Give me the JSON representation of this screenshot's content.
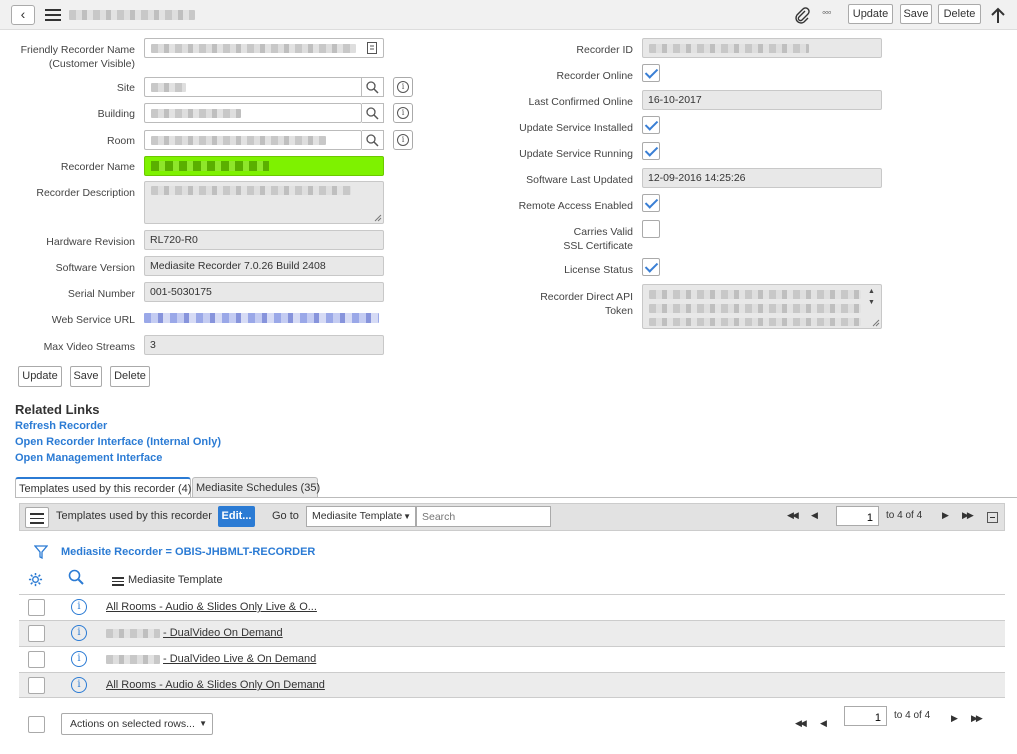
{
  "header": {
    "update_label": "Update",
    "save_label": "Save",
    "delete_label": "Delete",
    "more_glyph": "◦◦◦"
  },
  "form": {
    "friendly_name_label": "Friendly Recorder Name (Customer Visible)",
    "site_label": "Site",
    "building_label": "Building",
    "room_label": "Room",
    "recorder_name_label": "Recorder Name",
    "recorder_name_color": "#7ef200",
    "description_label": "Recorder Description",
    "hardware_revision_label": "Hardware Revision",
    "hardware_revision_value": "RL720-R0",
    "software_version_label": "Software Version",
    "software_version_value": "Mediasite Recorder 7.0.26 Build 2408",
    "serial_number_label": "Serial Number",
    "serial_number_value": "001-5030175",
    "web_service_url_label": "Web Service URL",
    "max_video_streams_label": "Max Video Streams",
    "max_video_streams_value": "3",
    "recorder_id_label": "Recorder ID",
    "recorder_online_label": "Recorder Online",
    "recorder_online": true,
    "last_confirmed_label": "Last Confirmed Online",
    "last_confirmed_value": "16-10-2017",
    "update_service_installed_label": "Update Service Installed",
    "update_service_installed": true,
    "update_service_running_label": "Update Service Running",
    "update_service_running": true,
    "software_last_updated_label": "Software Last Updated",
    "software_last_updated_value": "12-09-2016 14:25:26",
    "remote_access_label": "Remote Access Enabled",
    "remote_access": true,
    "valid_ssl_label": "Carries Valid SSL Certificate",
    "valid_ssl": false,
    "license_status_label": "License Status",
    "license_status": true,
    "api_token_label": "Recorder Direct API Token"
  },
  "form_buttons": {
    "update_label": "Update",
    "save_label": "Save",
    "delete_label": "Delete"
  },
  "related_links": {
    "title": "Related Links",
    "items": [
      "Refresh Recorder",
      "Open Recorder Interface (Internal Only)",
      "Open Management Interface"
    ]
  },
  "tabs": [
    {
      "label": "Templates used by this recorder (4)",
      "active": true
    },
    {
      "label": "Mediasite Schedules (35)",
      "active": false
    }
  ],
  "list": {
    "title": "Templates used by this recorder",
    "edit_label": "Edit...",
    "goto_label": "Go to",
    "goto_field": "Mediasite Template",
    "search_placeholder": "Search",
    "page_value": "1",
    "page_total": "to 4 of 4",
    "filter_text": "Mediasite Recorder = OBIS-JHBMLT-RECORDER",
    "column_header": "Mediasite Template",
    "rows": [
      {
        "name": "All Rooms - Audio & Slides Only Live & O..."
      },
      {
        "name": "- DualVideo On Demand"
      },
      {
        "name": "- DualVideo Live & On Demand"
      },
      {
        "name": "All Rooms - Audio & Slides Only On Demand"
      }
    ],
    "actions_label": "Actions on selected rows...",
    "accent_color": "#2b7bd4"
  }
}
